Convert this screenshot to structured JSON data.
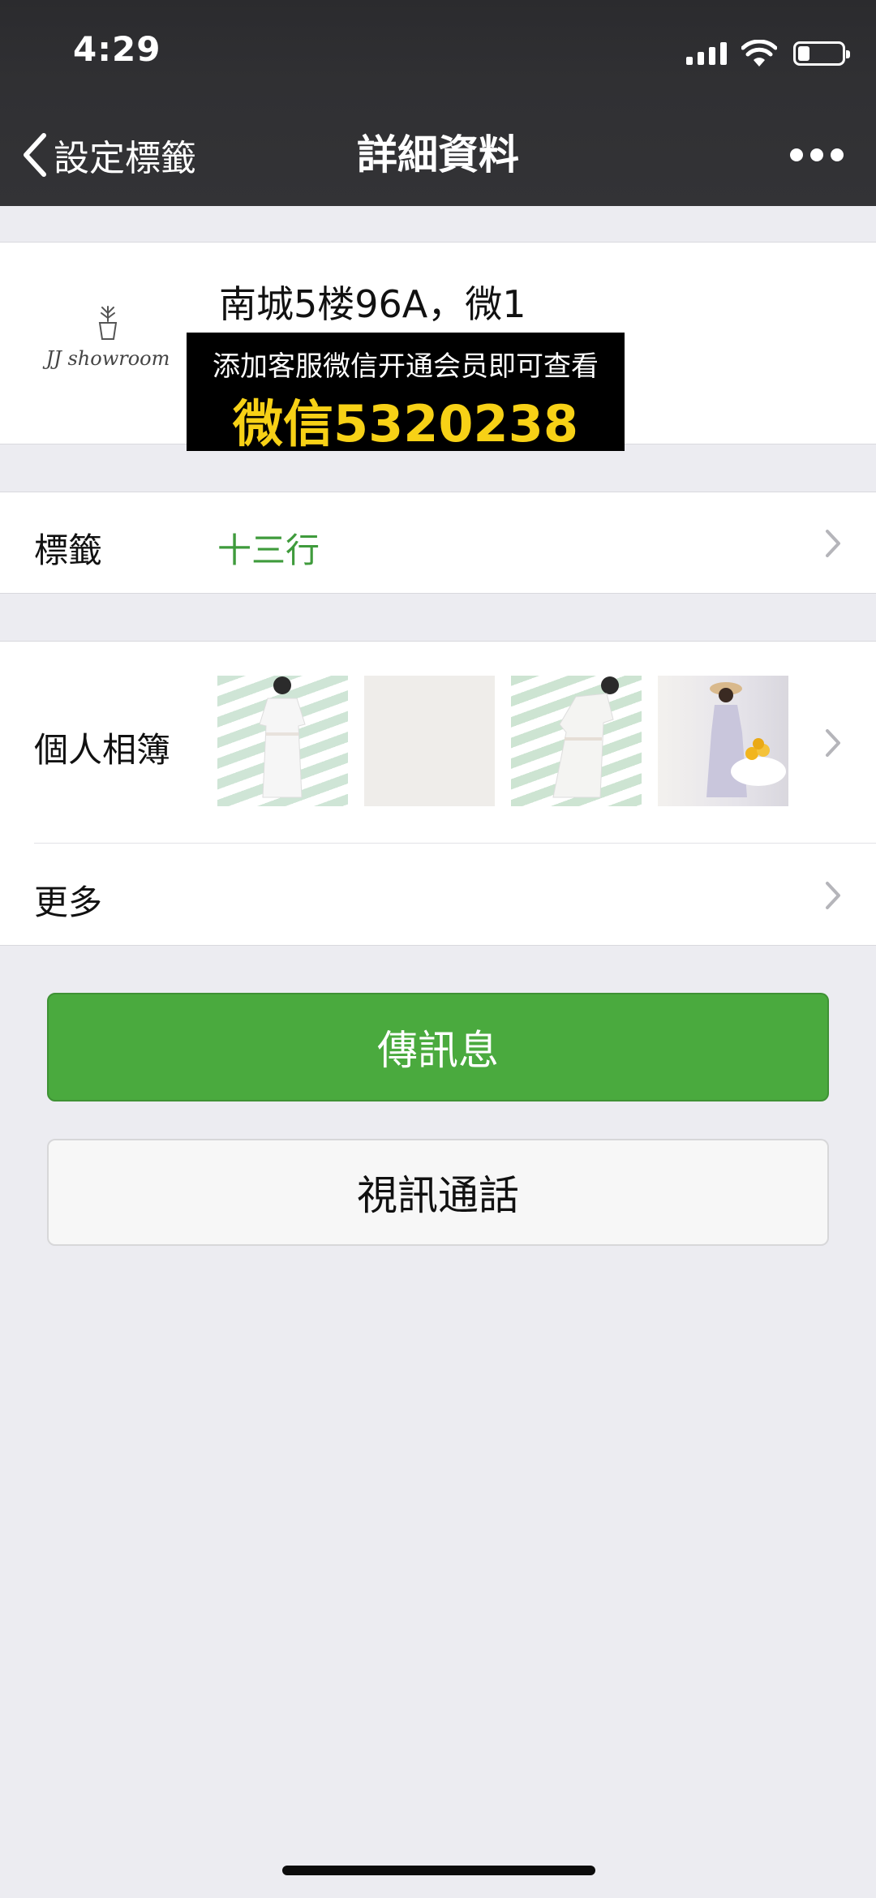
{
  "status_bar": {
    "time": "4:29",
    "icons": [
      "signal-icon",
      "wifi-icon",
      "battery-icon"
    ]
  },
  "nav": {
    "back_label": "設定標籤",
    "title": "詳細資料",
    "more_icon": "more-dots-icon"
  },
  "profile": {
    "avatar_text": "JJ showroom",
    "name": "南城5楼96A，微1"
  },
  "promo_banner": {
    "line1": "添加客服微信开通会员即可查看",
    "line2": "微信5320238"
  },
  "tag_row": {
    "label": "標籤",
    "value": "十三行",
    "value_color": "#3f9b3c"
  },
  "album_row": {
    "label": "個人相簿",
    "thumbnail_count": 4
  },
  "more_row": {
    "label": "更多"
  },
  "buttons": {
    "message": "傳訊息",
    "video_call": "視訊通話"
  },
  "colors": {
    "header_bg": "#2f2f32",
    "primary_button": "#4aaa3e",
    "page_bg": "#ececf1",
    "promo_highlight": "#f7d116"
  }
}
